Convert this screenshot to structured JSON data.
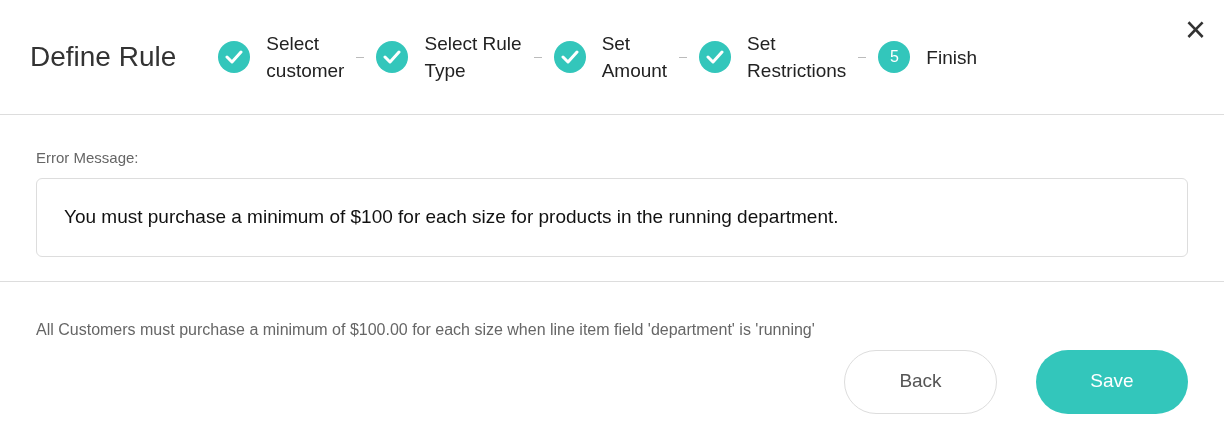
{
  "title": "Define Rule",
  "steps": [
    {
      "lines": [
        "Select",
        "customer"
      ],
      "completed": true
    },
    {
      "lines": [
        "Select Rule",
        "Type"
      ],
      "completed": true
    },
    {
      "lines": [
        "Set",
        "Amount"
      ],
      "completed": true
    },
    {
      "lines": [
        "Set",
        "Restrictions"
      ],
      "completed": true
    },
    {
      "lines": [
        "Finish"
      ],
      "completed": false,
      "number": "5"
    }
  ],
  "close": "×",
  "error_message": {
    "label": "Error Message:",
    "value": "You must purchase a minimum of $100 for each size for products in the running department."
  },
  "summary": "All Customers must purchase a minimum of $100.00 for each size when line item field 'department' is 'running'",
  "buttons": [
    {
      "label": "Back",
      "kind": "secondary"
    },
    {
      "label": "Save",
      "kind": "primary"
    }
  ]
}
